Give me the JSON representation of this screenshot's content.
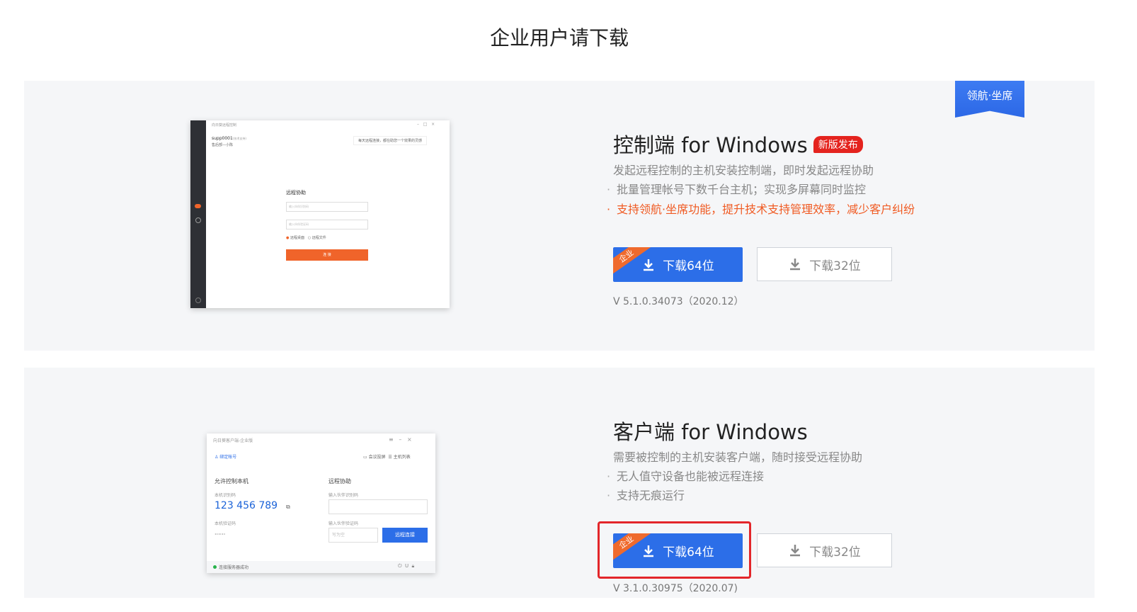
{
  "page": {
    "title": "企业用户请下载"
  },
  "ribbon": {
    "label": "领航·坐席"
  },
  "control": {
    "title": "控制端 for Windows",
    "badge": "新版发布",
    "description": "发起远程控制的主机安装控制端，即时发起远程协助",
    "bullets": [
      "批量管理帐号下数千台主机；实现多屏幕同时监控",
      "支持领航·坐席功能，提升技术支持管理效率，减少客户纠纷"
    ],
    "corner_tag": "企业",
    "download64": "下载64位",
    "download32": "下载32位",
    "version": "V 5.1.0.34073（2020.12）",
    "mock": {
      "window_title": "向日葵远程控制",
      "account": "supp0001",
      "account_tag": "(技术支持)",
      "account_sub": "售后部—小陈",
      "notice": "每天远程连接，都在助您一个效果的灵感",
      "heading": "远程协助",
      "input1": "输入伙伴识别码",
      "input2": "输入伙伴验证码",
      "option1": "远程桌面",
      "option2": "远程文件",
      "button": "连 接"
    }
  },
  "client": {
    "title": "客户端 for Windows",
    "description": "需要被控制的主机安装客户端，随时接受远程协助",
    "bullets": [
      "无人值守设备也能被远程连接",
      "支持无痕运行"
    ],
    "corner_tag": "企业",
    "download64": "下载64位",
    "download32": "下载32位",
    "version": "V 3.1.0.30975（2020.07)",
    "mock": {
      "window_title": "向日葵客户端-企业版",
      "bind": "绑定帐号",
      "meeting": "会议投屏",
      "host_list": "主机列表",
      "allow": "允许控制本机",
      "id_label": "本机识别码",
      "id_value": "123 456 789",
      "code_label": "本机验证码",
      "code_value": "······",
      "remote": "远程协助",
      "partner_id": "输入伙伴识别码",
      "partner_code": "输入伙伴验证码",
      "placeholder": "写为空",
      "connect": "远程连接",
      "status": "连接服务器成功"
    }
  },
  "colors": {
    "primary": "#2c6ee8",
    "accent": "#f05a22",
    "badge": "#e4231e",
    "highlight": "#e3262a"
  }
}
